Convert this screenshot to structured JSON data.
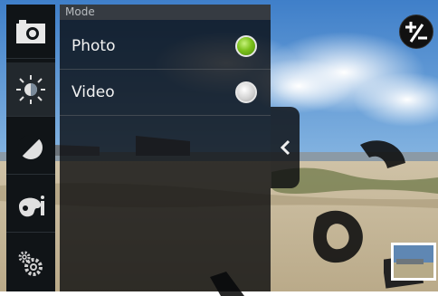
{
  "panel": {
    "header": "Mode",
    "options": [
      {
        "label": "Photo",
        "selected": true
      },
      {
        "label": "Video",
        "selected": false
      }
    ]
  },
  "sidebar": {
    "items": [
      {
        "icon": "camera-icon",
        "selected": false
      },
      {
        "icon": "brightness-icon",
        "selected": true
      },
      {
        "icon": "contrast-icon",
        "selected": false
      },
      {
        "icon": "color-effects-icon",
        "selected": false
      },
      {
        "icon": "settings-gears-icon",
        "selected": false
      }
    ]
  },
  "colors": {
    "selected_radio": "#7cc11c",
    "panel_background": "#06080a"
  }
}
